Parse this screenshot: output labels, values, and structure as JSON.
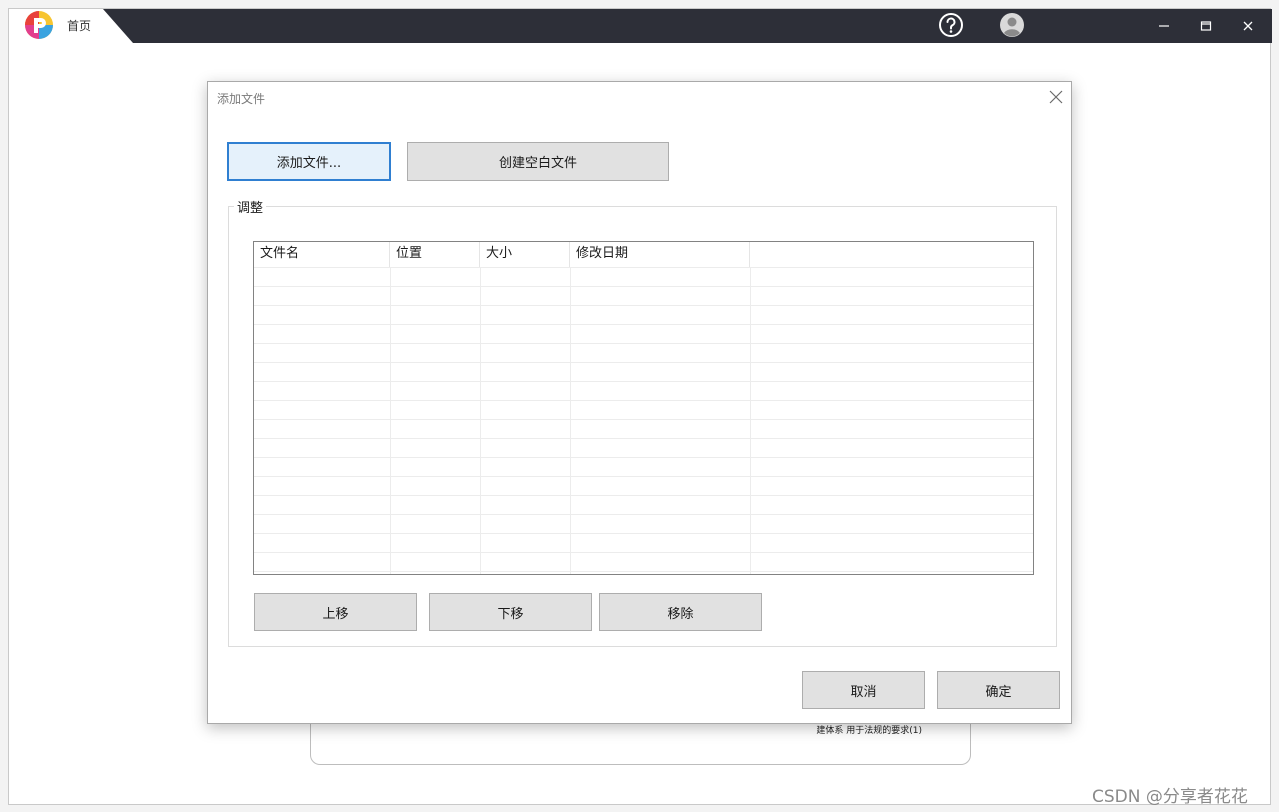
{
  "app": {
    "home_tab_label": "首页",
    "icons": {
      "help": "help-circle-icon",
      "user": "user-avatar-icon",
      "minimize": "minimize-icon",
      "maximize": "maximize-icon",
      "close": "close-icon"
    }
  },
  "background": {
    "card_text": "建体系 用于法规的要求(1)"
  },
  "dialog": {
    "title": "添加文件",
    "add_file_label": "添加文件...",
    "create_blank_label": "创建空白文件",
    "group_label": "调整",
    "columns": [
      "文件名",
      "位置",
      "大小",
      "修改日期"
    ],
    "rows": [],
    "move_up_label": "上移",
    "move_down_label": "下移",
    "remove_label": "移除",
    "cancel_label": "取消",
    "ok_label": "确定"
  },
  "watermark": "CSDN @分享者花花",
  "colors": {
    "titlebar": "#2d2f38",
    "focus_border": "#2f7fd1",
    "button_bg": "#e1e1e1"
  }
}
